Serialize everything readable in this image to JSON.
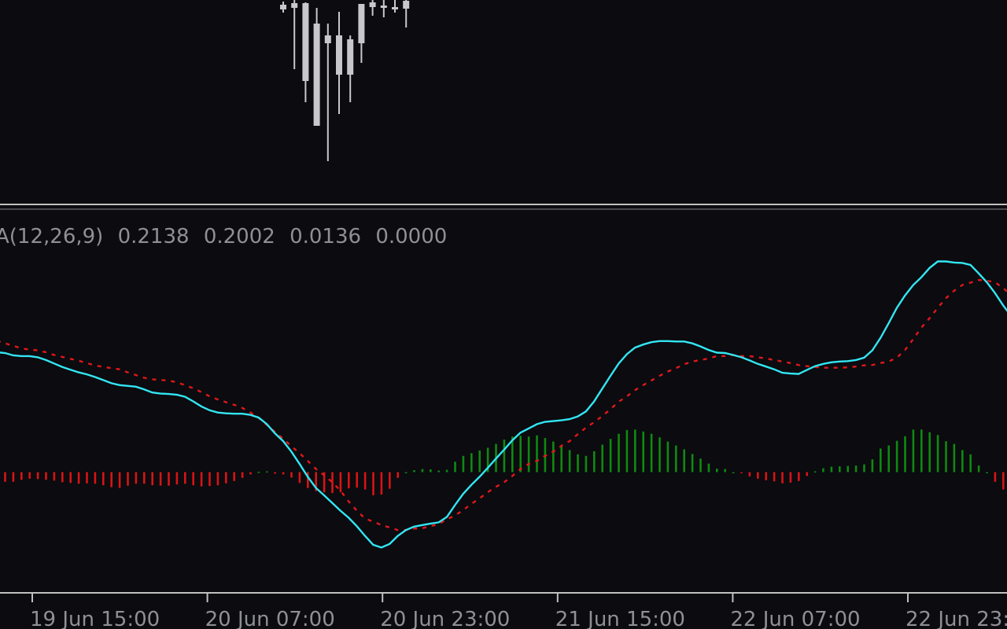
{
  "indicator": {
    "label": "A(12,26,9)",
    "values": [
      "0.2138",
      "0.2002",
      "0.0136",
      "0.0000"
    ]
  },
  "time_axis": {
    "ticks": [
      "19 Jun 15:00",
      "20 Jun 07:00",
      "20 Jun 23:00",
      "21 Jun 15:00",
      "22 Jun 07:00",
      "22 Jun 23:00"
    ]
  },
  "colors": {
    "background": "#0b0b10",
    "separator": "#c0c0c0",
    "candle": "#c8c8cc",
    "macd_line": "#33e6f2",
    "signal_line": "#e01818",
    "hist_positive": "#0f8a0f",
    "hist_negative": "#d81414"
  },
  "chart_data": [
    {
      "type": "candlestick",
      "panel": "price",
      "candles": [
        {
          "o": 0.06,
          "h": 0.02,
          "l": 0.16,
          "c": 0.12
        },
        {
          "o": 0.1,
          "h": 0.0,
          "l": 0.88,
          "c": 0.04
        },
        {
          "o": 0.04,
          "h": 0.03,
          "l": 1.3,
          "c": 1.03
        },
        {
          "o": 0.3,
          "h": 0.1,
          "l": 1.3,
          "c": 1.6
        },
        {
          "o": 0.55,
          "h": 0.3,
          "l": 2.05,
          "c": 0.45
        },
        {
          "o": 0.45,
          "h": 0.15,
          "l": 1.45,
          "c": 0.95
        },
        {
          "o": 0.95,
          "h": 0.45,
          "l": 1.3,
          "c": 0.5
        },
        {
          "o": 0.55,
          "h": 0.05,
          "l": 0.8,
          "c": 0.05
        },
        {
          "o": 0.03,
          "h": 0.0,
          "l": 0.2,
          "c": 0.09
        },
        {
          "o": 0.07,
          "h": 0.0,
          "l": 0.22,
          "c": 0.1
        },
        {
          "o": 0.09,
          "h": 0.0,
          "l": 0.16,
          "c": 0.11
        },
        {
          "o": 0.11,
          "h": 0.0,
          "l": 0.35,
          "c": 0.01
        }
      ]
    },
    {
      "type": "line+bar",
      "panel": "MACD",
      "ylim": [
        -0.3,
        0.55
      ],
      "series": [
        {
          "kind": "line",
          "values": [
            0.31,
            0.308,
            0.302,
            0.3,
            0.3,
            0.297,
            0.29,
            0.281,
            0.272,
            0.265,
            0.258,
            0.253,
            0.246,
            0.238,
            0.23,
            0.225,
            0.223,
            0.221,
            0.214,
            0.206,
            0.203,
            0.202,
            0.2,
            0.195,
            0.183,
            0.17,
            0.16,
            0.154,
            0.152,
            0.151,
            0.151,
            0.148,
            0.141,
            0.124,
            0.1,
            0.08,
            0.053,
            0.021,
            -0.012,
            -0.041,
            -0.06,
            -0.08,
            -0.1,
            -0.118,
            -0.14,
            -0.165,
            -0.188,
            -0.195,
            -0.186,
            -0.165,
            -0.15,
            -0.141,
            -0.137,
            -0.133,
            -0.13,
            -0.116,
            -0.085,
            -0.056,
            -0.033,
            -0.012,
            0.011,
            0.035,
            0.058,
            0.082,
            0.102,
            0.113,
            0.124,
            0.13,
            0.132,
            0.134,
            0.137,
            0.144,
            0.157,
            0.183,
            0.216,
            0.249,
            0.281,
            0.305,
            0.322,
            0.33,
            0.336,
            0.339,
            0.339,
            0.338,
            0.338,
            0.333,
            0.325,
            0.316,
            0.309,
            0.308,
            0.303,
            0.297,
            0.289,
            0.28,
            0.273,
            0.266,
            0.257,
            0.255,
            0.254,
            0.264,
            0.274,
            0.28,
            0.284,
            0.286,
            0.287,
            0.29,
            0.296,
            0.315,
            0.347,
            0.385,
            0.425,
            0.457,
            0.484,
            0.504,
            0.528,
            0.545,
            0.545,
            0.542,
            0.541,
            0.536,
            0.514,
            0.491,
            0.463,
            0.431,
            0.403,
            0.385,
            0.37,
            0.355
          ]
        },
        {
          "kind": "line",
          "dashed": true,
          "values": [
            0.34,
            0.333,
            0.327,
            0.32,
            0.317,
            0.315,
            0.31,
            0.303,
            0.298,
            0.293,
            0.288,
            0.282,
            0.276,
            0.272,
            0.269,
            0.266,
            0.258,
            0.251,
            0.244,
            0.24,
            0.238,
            0.237,
            0.232,
            0.225,
            0.217,
            0.207,
            0.196,
            0.188,
            0.181,
            0.174,
            0.166,
            0.154,
            0.14,
            0.122,
            0.104,
            0.086,
            0.067,
            0.049,
            0.029,
            0.008,
            -0.008,
            -0.026,
            -0.048,
            -0.076,
            -0.1,
            -0.12,
            -0.128,
            -0.137,
            -0.143,
            -0.15,
            -0.15,
            -0.146,
            -0.145,
            -0.14,
            -0.134,
            -0.122,
            -0.112,
            -0.098,
            -0.082,
            -0.068,
            -0.052,
            -0.038,
            -0.026,
            -0.01,
            0.008,
            0.021,
            0.029,
            0.042,
            0.053,
            0.068,
            0.08,
            0.098,
            0.115,
            0.129,
            0.145,
            0.163,
            0.182,
            0.196,
            0.212,
            0.225,
            0.237,
            0.249,
            0.26,
            0.269,
            0.279,
            0.286,
            0.29,
            0.294,
            0.3,
            0.3,
            0.303,
            0.3,
            0.3,
            0.297,
            0.294,
            0.29,
            0.286,
            0.282,
            0.277,
            0.274,
            0.272,
            0.27,
            0.27,
            0.27,
            0.271,
            0.273,
            0.276,
            0.277,
            0.282,
            0.286,
            0.296,
            0.316,
            0.344,
            0.374,
            0.398,
            0.425,
            0.45,
            0.469,
            0.484,
            0.49,
            0.497,
            0.495,
            0.491,
            0.476,
            0.457,
            0.438,
            0.42,
            0.406
          ]
        },
        {
          "kind": "bar",
          "values": [
            -0.03,
            -0.025,
            -0.025,
            -0.02,
            -0.017,
            -0.018,
            -0.02,
            -0.022,
            -0.026,
            -0.028,
            -0.03,
            -0.029,
            -0.03,
            -0.034,
            -0.039,
            -0.041,
            -0.035,
            -0.03,
            -0.03,
            -0.034,
            -0.035,
            -0.035,
            -0.032,
            -0.03,
            -0.034,
            -0.037,
            -0.036,
            -0.034,
            -0.029,
            -0.023,
            -0.015,
            -0.006,
            0.001,
            0.002,
            -0.004,
            -0.006,
            -0.014,
            -0.028,
            -0.041,
            -0.049,
            -0.052,
            -0.054,
            -0.052,
            -0.042,
            -0.04,
            -0.045,
            -0.06,
            -0.058,
            -0.043,
            -0.015,
            0.0,
            0.005,
            0.008,
            0.007,
            0.004,
            0.006,
            0.027,
            0.042,
            0.049,
            0.056,
            0.063,
            0.073,
            0.084,
            0.092,
            0.094,
            0.092,
            0.095,
            0.088,
            0.079,
            0.066,
            0.057,
            0.046,
            0.042,
            0.054,
            0.071,
            0.086,
            0.099,
            0.109,
            0.11,
            0.105,
            0.099,
            0.09,
            0.079,
            0.069,
            0.059,
            0.047,
            0.035,
            0.022,
            0.009,
            0.008,
            0.0,
            -0.003,
            -0.011,
            -0.017,
            -0.021,
            -0.024,
            -0.029,
            -0.027,
            -0.023,
            -0.01,
            0.002,
            0.01,
            0.014,
            0.015,
            0.016,
            0.017,
            0.02,
            0.033,
            0.061,
            0.069,
            0.081,
            0.093,
            0.11,
            0.11,
            0.103,
            0.096,
            0.08,
            0.073,
            0.057,
            0.046,
            0.017,
            0.0,
            -0.025,
            -0.045,
            -0.051,
            -0.053,
            -0.052,
            -0.051
          ]
        }
      ]
    }
  ]
}
